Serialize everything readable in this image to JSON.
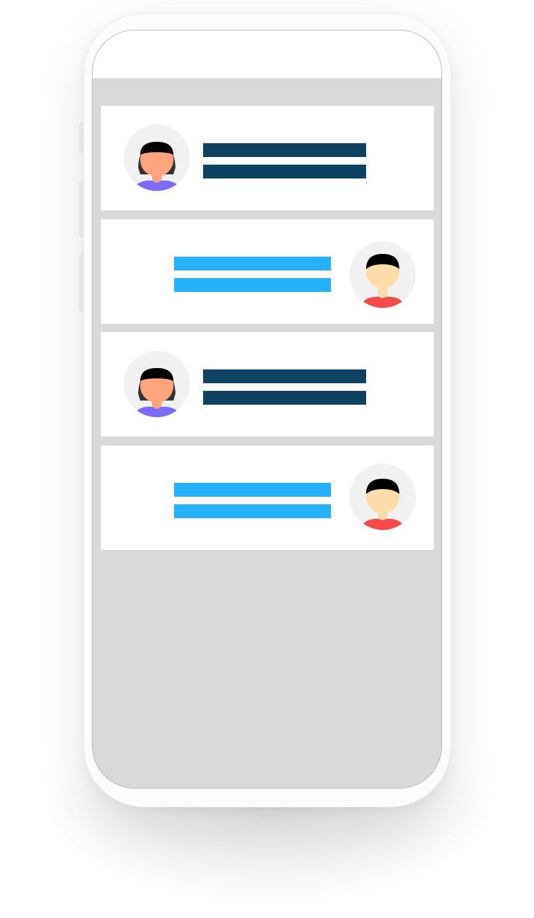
{
  "colors": {
    "screen_background": "#d9d9d9",
    "card_background": "#ffffff",
    "incoming_message_bar": "#0f4160",
    "outgoing_message_bar": "#26b1fd",
    "avatar_background": "#f1f1f1",
    "female_skin": "#fea47e",
    "female_shirt": "#7c6bff",
    "male_skin": "#fedca9",
    "male_shirt": "#f94a4a",
    "hair": "#000000"
  },
  "messages": [
    {
      "direction": "incoming",
      "avatar": "female-avatar-icon",
      "bar_count": 2
    },
    {
      "direction": "outgoing",
      "avatar": "male-avatar-icon",
      "bar_count": 2
    },
    {
      "direction": "incoming",
      "avatar": "female-avatar-icon",
      "bar_count": 2
    },
    {
      "direction": "outgoing",
      "avatar": "male-avatar-icon",
      "bar_count": 2
    }
  ]
}
